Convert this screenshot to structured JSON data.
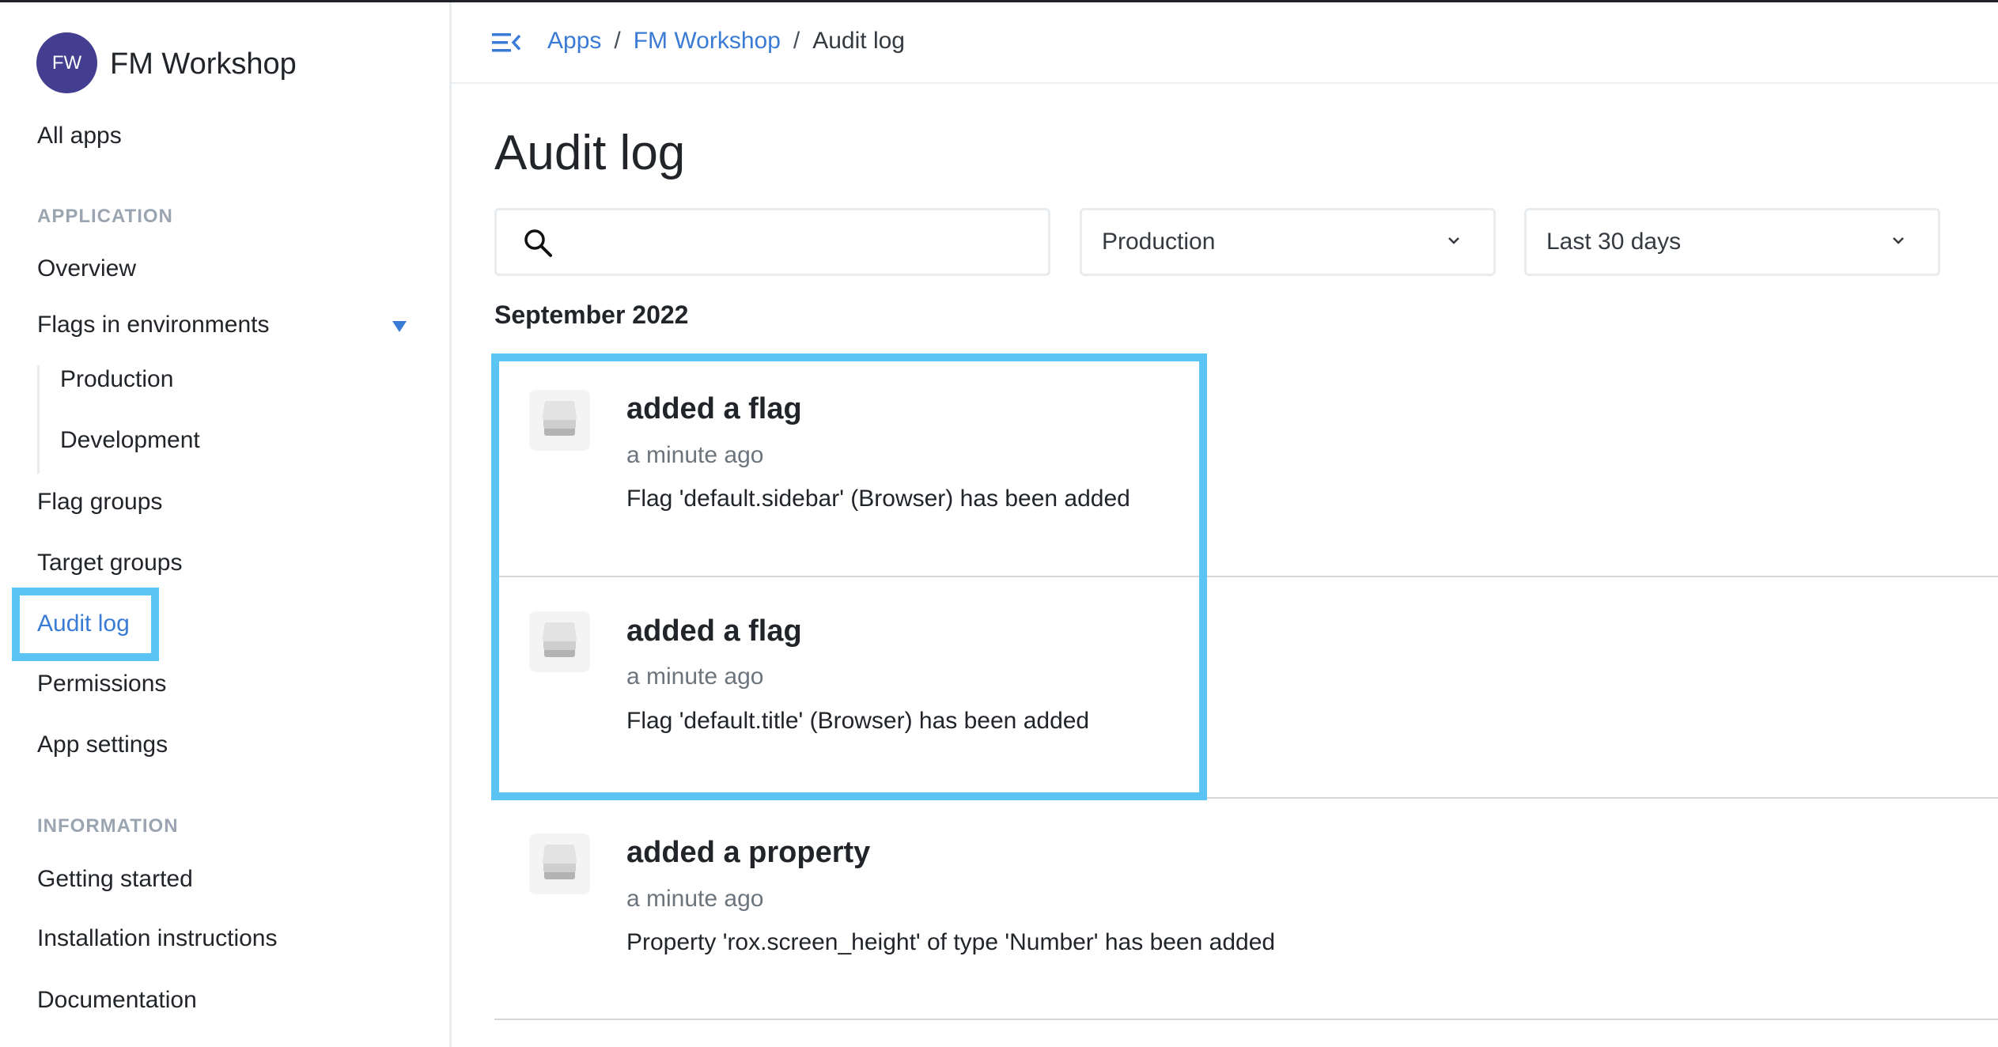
{
  "app": {
    "avatar_initials": "FW",
    "name": "FM Workshop",
    "avatar_color": "#433e90",
    "accent_color": "#3a7bd5",
    "highlight_color": "#5bc4f5"
  },
  "sidebar": {
    "all_apps": "All apps",
    "sections": [
      {
        "title": "APPLICATION",
        "items": [
          {
            "label": "Overview"
          },
          {
            "label": "Flags in environments",
            "expanded": true,
            "children": [
              {
                "label": "Production"
              },
              {
                "label": "Development"
              }
            ]
          },
          {
            "label": "Flag groups"
          },
          {
            "label": "Target groups"
          },
          {
            "label": "Audit log",
            "active": true
          },
          {
            "label": "Permissions"
          },
          {
            "label": "App settings"
          }
        ]
      },
      {
        "title": "INFORMATION",
        "items": [
          {
            "label": "Getting started"
          },
          {
            "label": "Installation instructions"
          },
          {
            "label": "Documentation"
          }
        ]
      }
    ]
  },
  "header": {
    "menu_icon": "collapse-menu-icon",
    "breadcrumb": [
      {
        "label": "Apps",
        "link": true
      },
      {
        "label": "FM Workshop",
        "link": true
      },
      {
        "label": "Audit log",
        "link": false
      }
    ],
    "separator": "/"
  },
  "main": {
    "title": "Audit log",
    "search": {
      "value": "",
      "placeholder": "",
      "icon": "search-icon"
    },
    "filters": {
      "environment": "Production",
      "range": "Last 30 days"
    },
    "month": "September 2022",
    "entries": [
      {
        "icon": "stack-icon",
        "title": "added a flag",
        "time": "a minute ago",
        "description": "Flag 'default.sidebar' (Browser) has been added"
      },
      {
        "icon": "stack-icon",
        "title": "added a flag",
        "time": "a minute ago",
        "description": "Flag 'default.title' (Browser) has been added"
      },
      {
        "icon": "stack-icon",
        "title": "added a property",
        "time": "a minute ago",
        "description": "Property 'rox.screen_height' of type 'Number' has been added"
      }
    ]
  }
}
